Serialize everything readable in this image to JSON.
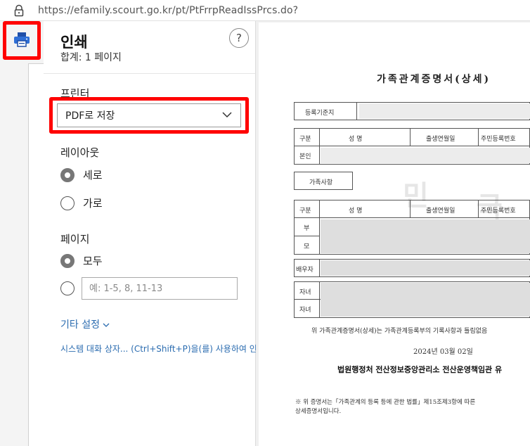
{
  "browser": {
    "url": "https://efamily.scourt.go.kr/pt/PtFrrpReadIssPrcs.do?"
  },
  "dialog": {
    "title": "인쇄",
    "subtitle": "합계: 1 페이지",
    "help_label": "?",
    "printer_label": "프린터",
    "printer_selected": "PDF로 저장",
    "layout_label": "레이아웃",
    "layout_options": [
      {
        "label": "세로",
        "selected": true
      },
      {
        "label": "가로",
        "selected": false
      }
    ],
    "pages_label": "페이지",
    "pages_options": [
      {
        "label": "모두",
        "selected": true
      }
    ],
    "pages_range_placeholder": "예: 1-5, 8, 11-13",
    "more_settings": "기타 설정",
    "system_dialog_link": "시스템 대화 상자... (Ctrl+Shift+P)을(를) 사용하여 인"
  },
  "preview": {
    "doc_title": "가족관계증명서(상세)",
    "reg_base_label": "등록기준지",
    "person_headers": [
      "구분",
      "성    명",
      "출생연월일",
      "주민등록번호"
    ],
    "self_label": "본인",
    "family_section_label": "가족사항",
    "family_headers": [
      "구분",
      "성    명",
      "출생연월일",
      "주민등록번호"
    ],
    "family_rows": [
      "부",
      "모"
    ],
    "spouse_label": "배우자",
    "child_rows": [
      "자녀",
      "자녀"
    ],
    "watermark": [
      "민",
      "국"
    ],
    "statement": "위 가족관계증명서(상세)는 가족관계등록부의 기록사항과 틀림없음",
    "issue_date": "2024년 03월 02일",
    "issuer": "법원행정처 전산정보중앙관리소 전산운영책임관 유",
    "note_line1": "※ 위 증명서는「가족관계의 등록 등에 관한 법률」제15조제3항에 따른",
    "note_line2": "상세증명서입니다."
  },
  "colors": {
    "highlight": "#ff0000",
    "link": "#2b6cb0"
  }
}
